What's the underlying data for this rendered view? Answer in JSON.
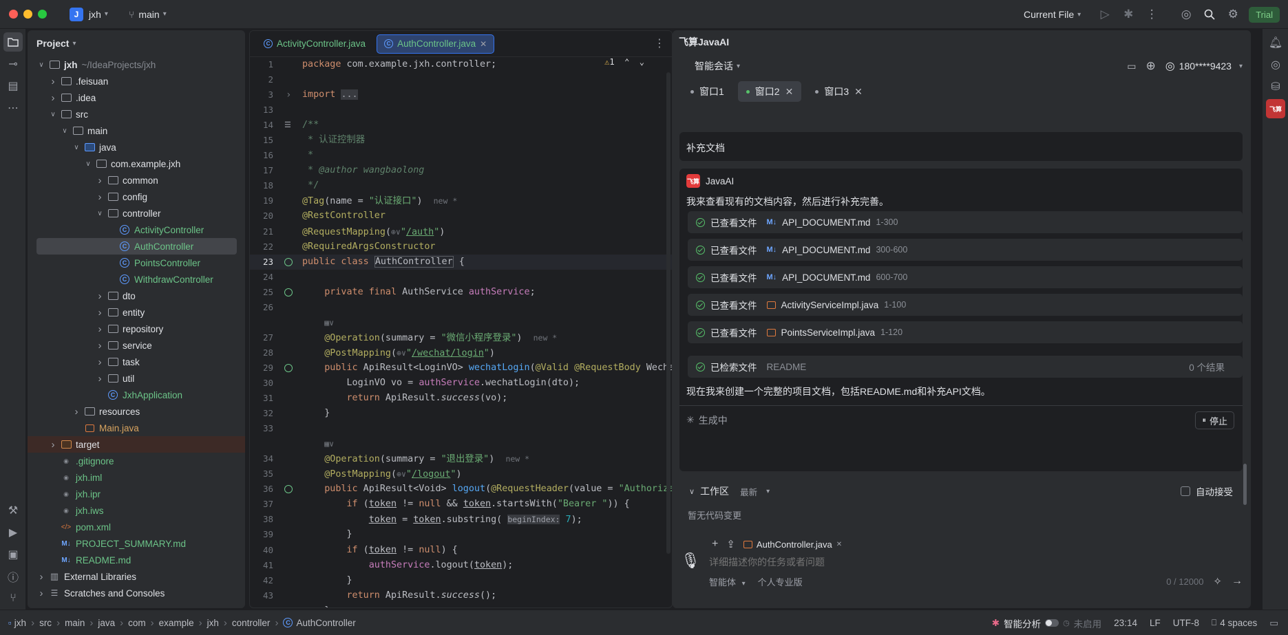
{
  "titlebar": {
    "project_badge": "J",
    "project_name": "jxh",
    "branch": "main",
    "run_config": "Current File",
    "trial_label": "Trial"
  },
  "project_pane": {
    "title": "Project",
    "tree": [
      {
        "depth": 0,
        "arrow": "v",
        "icon": "folder",
        "label": "jxh",
        "extra": "~/IdeaProjects/jxh",
        "style": "bold"
      },
      {
        "depth": 1,
        "arrow": ">",
        "icon": "folder",
        "label": ".feisuan"
      },
      {
        "depth": 1,
        "arrow": ">",
        "icon": "folder",
        "label": ".idea"
      },
      {
        "depth": 1,
        "arrow": "v",
        "icon": "folder",
        "label": "src"
      },
      {
        "depth": 2,
        "arrow": "v",
        "icon": "folder",
        "label": "main"
      },
      {
        "depth": 3,
        "arrow": "v",
        "icon": "folder-blue",
        "label": "java"
      },
      {
        "depth": 4,
        "arrow": "v",
        "icon": "package",
        "label": "com.example.jxh"
      },
      {
        "depth": 5,
        "arrow": ">",
        "icon": "package",
        "label": "common"
      },
      {
        "depth": 5,
        "arrow": ">",
        "icon": "package",
        "label": "config"
      },
      {
        "depth": 5,
        "arrow": "v",
        "icon": "package",
        "label": "controller"
      },
      {
        "depth": 6,
        "arrow": "",
        "icon": "class",
        "label": "ActivityController",
        "style": "green"
      },
      {
        "depth": 6,
        "arrow": "",
        "icon": "class",
        "label": "AuthController",
        "style": "green",
        "selected": true
      },
      {
        "depth": 6,
        "arrow": "",
        "icon": "class",
        "label": "PointsController",
        "style": "green"
      },
      {
        "depth": 6,
        "arrow": "",
        "icon": "class",
        "label": "WithdrawController",
        "style": "green"
      },
      {
        "depth": 5,
        "arrow": ">",
        "icon": "package",
        "label": "dto"
      },
      {
        "depth": 5,
        "arrow": ">",
        "icon": "package",
        "label": "entity"
      },
      {
        "depth": 5,
        "arrow": ">",
        "icon": "package",
        "label": "repository"
      },
      {
        "depth": 5,
        "arrow": ">",
        "icon": "package",
        "label": "service"
      },
      {
        "depth": 5,
        "arrow": ">",
        "icon": "package",
        "label": "task"
      },
      {
        "depth": 5,
        "arrow": ">",
        "icon": "package",
        "label": "util"
      },
      {
        "depth": 5,
        "arrow": "",
        "icon": "class",
        "label": "JxhApplication",
        "style": "green"
      },
      {
        "depth": 3,
        "arrow": ">",
        "icon": "folder",
        "label": "resources"
      },
      {
        "depth": 3,
        "arrow": "",
        "icon": "java-file",
        "label": "Main.java",
        "style": "orange"
      },
      {
        "depth": 1,
        "arrow": ">",
        "icon": "folder-orange",
        "label": "target",
        "highlight": true
      },
      {
        "depth": 1,
        "arrow": "",
        "icon": "file",
        "label": ".gitignore",
        "style": "green"
      },
      {
        "depth": 1,
        "arrow": "",
        "icon": "file",
        "label": "jxh.iml",
        "style": "green"
      },
      {
        "depth": 1,
        "arrow": "",
        "icon": "file",
        "label": "jxh.ipr",
        "style": "green"
      },
      {
        "depth": 1,
        "arrow": "",
        "icon": "file",
        "label": "jxh.iws",
        "style": "green"
      },
      {
        "depth": 1,
        "arrow": "",
        "icon": "xml",
        "label": "pom.xml",
        "style": "green"
      },
      {
        "depth": 1,
        "arrow": "",
        "icon": "md",
        "label": "PROJECT_SUMMARY.md",
        "style": "green"
      },
      {
        "depth": 1,
        "arrow": "",
        "icon": "md",
        "label": "README.md",
        "style": "green"
      },
      {
        "depth": 0,
        "arrow": ">",
        "icon": "library",
        "label": "External Libraries"
      },
      {
        "depth": 0,
        "arrow": ">",
        "icon": "scratch",
        "label": "Scratches and Consoles"
      }
    ]
  },
  "editor": {
    "tabs": [
      {
        "label": "ActivityController.java",
        "active": false
      },
      {
        "label": "AuthController.java",
        "active": true
      }
    ],
    "warning_count": "1",
    "lines": [
      {
        "n": "1",
        "html": "<span style='color:#cf8e6d'>package</span> com.example.jxh.controller;"
      },
      {
        "n": "2",
        "html": ""
      },
      {
        "n": "3",
        "html": "<span style='color:#cf8e6d'>import</span> <span style='background:#393b40;color:#9da0a8'>...</span>",
        "fold": true
      },
      {
        "n": "13",
        "html": ""
      },
      {
        "n": "14",
        "html": "<span style='color:#5f826b'>/**</span>",
        "doc": true
      },
      {
        "n": "15",
        "html": "<span style='color:#5f826b'> * 认证控制器</span>"
      },
      {
        "n": "16",
        "html": "<span style='color:#5f826b'> *</span>"
      },
      {
        "n": "17",
        "html": "<span style='color:#5f826b'> * <i>@author</i> <i>wangbaolong</i></span>"
      },
      {
        "n": "18",
        "html": "<span style='color:#5f826b'> */</span>"
      },
      {
        "n": "19",
        "html": "<span style='color:#b3ae60'>@Tag</span>(name = <span style='color:#6aab73'>\"认证接口\"</span>)  <span class='inlay'>new *</span>"
      },
      {
        "n": "20",
        "html": "<span style='color:#b3ae60'>@RestController</span>"
      },
      {
        "n": "21",
        "html": "<span style='color:#b3ae60'>@RequestMapping</span>(<span class='inlay'>⊕∨</span><span style='color:#6aab73'>\"<u>/auth</u>\"</span>)"
      },
      {
        "n": "22",
        "html": "<span style='color:#b3ae60'>@RequiredArgsConstructor</span>"
      },
      {
        "n": "23",
        "html": "<span style='color:#cf8e6d'>public class</span> <span style='border:1px solid #5a5d63'>AuthController</span> {",
        "gutter": true,
        "current": true
      },
      {
        "n": "24",
        "html": ""
      },
      {
        "n": "25",
        "html": "    <span style='color:#cf8e6d'>private final</span> AuthService <span style='color:#c77dbb'>authService</span>;",
        "gutter": true
      },
      {
        "n": "26",
        "html": ""
      },
      {
        "n": "",
        "html": "    <span class='inlay'>▦∨</span>"
      },
      {
        "n": "27",
        "html": "    <span style='color:#b3ae60'>@Operation</span>(summary = <span style='color:#6aab73'>\"微信小程序登录\"</span>)  <span class='inlay'>new *</span>"
      },
      {
        "n": "28",
        "html": "    <span style='color:#b3ae60'>@PostMapping</span>(<span class='inlay'>⊕∨</span><span style='color:#6aab73'>\"<u>/wechat/login</u>\"</span>)"
      },
      {
        "n": "29",
        "html": "    <span style='color:#cf8e6d'>public</span> ApiResult&lt;LoginVO&gt; <span style='color:#56a8f5'>wechatLogin</span>(<span style='color:#b3ae60'>@Valid</span> <span style='color:#b3ae60'>@RequestBody</span> WechatLoginDTO dto) {",
        "gutter": true
      },
      {
        "n": "30",
        "html": "        LoginVO vo = <span style='color:#c77dbb'>authService</span>.wechatLogin(dto);"
      },
      {
        "n": "31",
        "html": "        <span style='color:#cf8e6d'>return</span> ApiResult.<i>success</i>(vo);"
      },
      {
        "n": "32",
        "html": "    }"
      },
      {
        "n": "33",
        "html": ""
      },
      {
        "n": "",
        "html": "    <span class='inlay'>▦∨</span>"
      },
      {
        "n": "34",
        "html": "    <span style='color:#b3ae60'>@Operation</span>(summary = <span style='color:#6aab73'>\"退出登录\"</span>)  <span class='inlay'>new *</span>"
      },
      {
        "n": "35",
        "html": "    <span style='color:#b3ae60'>@PostMapping</span>(<span class='inlay'>⊕∨</span><span style='color:#6aab73'>\"<u>/logout</u>\"</span>)"
      },
      {
        "n": "36",
        "html": "    <span style='color:#cf8e6d'>public</span> ApiResult&lt;Void&gt; <span style='color:#56a8f5'>logout</span>(<span style='color:#b3ae60'>@RequestHeader</span>(value = <span style='color:#6aab73'>\"Authorization\"</span>) String token) {",
        "gutter": true
      },
      {
        "n": "37",
        "html": "        <span style='color:#cf8e6d'>if</span> (<u>token</u> != <span style='color:#cf8e6d'>null</span> &amp;&amp; <u>token</u>.startsWith(<span style='color:#6aab73'>\"Bearer \"</span>)) {"
      },
      {
        "n": "38",
        "html": "            <u>token</u> = <u>token</u>.substring( <span style='background:#393b40;color:#9da0a8;font-size:11.5px'>beginIndex:</span> <span style='color:#2aacb8'>7</span>);"
      },
      {
        "n": "39",
        "html": "        }"
      },
      {
        "n": "40",
        "html": "        <span style='color:#cf8e6d'>if</span> (<u>token</u> != <span style='color:#cf8e6d'>null</span>) {"
      },
      {
        "n": "41",
        "html": "            <span style='color:#c77dbb'>authService</span>.logout(<u>token</u>);"
      },
      {
        "n": "42",
        "html": "        }"
      },
      {
        "n": "43",
        "html": "        <span style='color:#cf8e6d'>return</span> ApiResult.<i>success</i>();"
      },
      {
        "n": "44",
        "html": "    }"
      }
    ]
  },
  "ai": {
    "title": "飞算JavaAI",
    "mode": "智能会话",
    "account": "180****9423",
    "windows": [
      {
        "label": "窗口1",
        "active": false,
        "closable": false
      },
      {
        "label": "窗口2",
        "active": true,
        "closable": true
      },
      {
        "label": "窗口3",
        "active": false,
        "closable": true
      }
    ],
    "prev_message": "补充文档",
    "sender": "JavaAI",
    "logo_text": "飞算",
    "intro": "我来查看现有的文档内容，然后进行补充完善。",
    "file_actions": [
      {
        "action": "已查看文件",
        "kind": "md",
        "file": "API_DOCUMENT.md",
        "range": "1-300"
      },
      {
        "action": "已查看文件",
        "kind": "md",
        "file": "API_DOCUMENT.md",
        "range": "300-600"
      },
      {
        "action": "已查看文件",
        "kind": "md",
        "file": "API_DOCUMENT.md",
        "range": "600-700"
      },
      {
        "action": "已查看文件",
        "kind": "java",
        "file": "ActivityServiceImpl.java",
        "range": "1-100"
      },
      {
        "action": "已查看文件",
        "kind": "java",
        "file": "PointsServiceImpl.java",
        "range": "1-120"
      }
    ],
    "search": {
      "action": "已检索文件",
      "query": "README",
      "result": "0 个结果"
    },
    "conclusion": "现在我来创建一个完整的项目文档，包括README.md和补充API文档。",
    "generating": "生成中",
    "stop": "停止",
    "workspace": "工作区",
    "workspace_filter": "最新",
    "auto_accept": "自动接受",
    "no_changes": "暂无代码变更",
    "attached_file": "AuthController.java",
    "input_placeholder": "详细描述你的任务或者问题",
    "agent_mode": "智能体",
    "edition": "个人专业版",
    "char_count": "0 / 12000"
  },
  "status": {
    "breadcrumb": [
      "jxh",
      "src",
      "main",
      "java",
      "com",
      "example",
      "jxh",
      "controller",
      "AuthController"
    ],
    "analysis": "智能分析",
    "analysis_state": "未启用",
    "position": "23:14",
    "line_sep": "LF",
    "encoding": "UTF-8",
    "indent": "4 spaces"
  }
}
